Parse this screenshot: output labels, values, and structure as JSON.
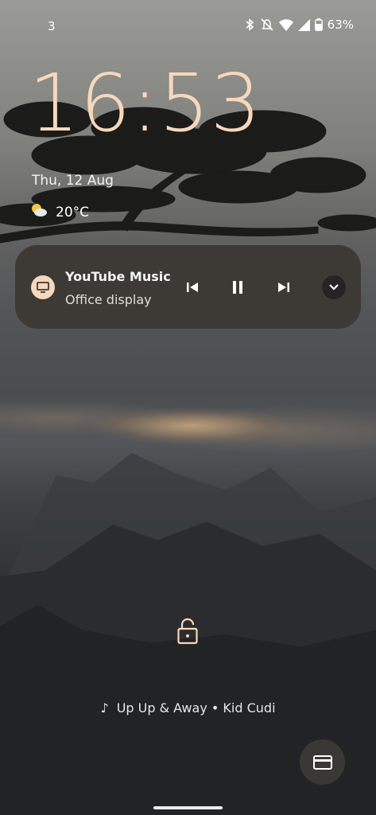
{
  "status_bar": {
    "notification_count": "3",
    "battery_percent": "63%",
    "icons": [
      "bluetooth-icon",
      "mute-icon",
      "wifi-icon",
      "signal-icon",
      "battery-icon"
    ]
  },
  "lockscreen": {
    "time": "16:53",
    "date": "Thu, 12 Aug",
    "weather": {
      "icon": "partly-cloudy-icon",
      "temperature": "20°C"
    }
  },
  "media": {
    "app_name": "YouTube Music",
    "device": "Office display",
    "icons": [
      "cast-display-icon",
      "previous-icon",
      "pause-icon",
      "next-icon",
      "chevron-down-icon"
    ]
  },
  "now_playing": {
    "text": "Up Up & Away • Kid Cudi"
  },
  "colors": {
    "clock": "#f6d8bd",
    "media_card": "#3d3a36",
    "accent": "#f6d8bd"
  }
}
